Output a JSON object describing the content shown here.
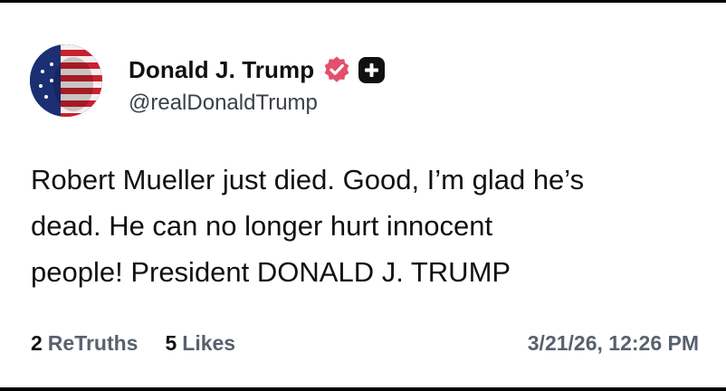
{
  "post": {
    "author_name": "Donald J. Trump",
    "author_handle": "@realDonaldTrump",
    "body": "Robert Mueller just died. Good, I’m glad he’s\ndead. He can no longer hurt innocent\npeople! President DONALD J. TRUMP",
    "retruths_count": "2",
    "retruths_label": "ReTruths",
    "likes_count": "5",
    "likes_label": "Likes",
    "timestamp": "3/21/26, 12:26 PM"
  },
  "icons": {
    "verified": "verified-badge-icon",
    "plus": "plus-badge-icon"
  },
  "colors": {
    "verified": "#e2506c",
    "muted_text": "#59616e",
    "text": "#111111",
    "background": "#ffffff"
  }
}
